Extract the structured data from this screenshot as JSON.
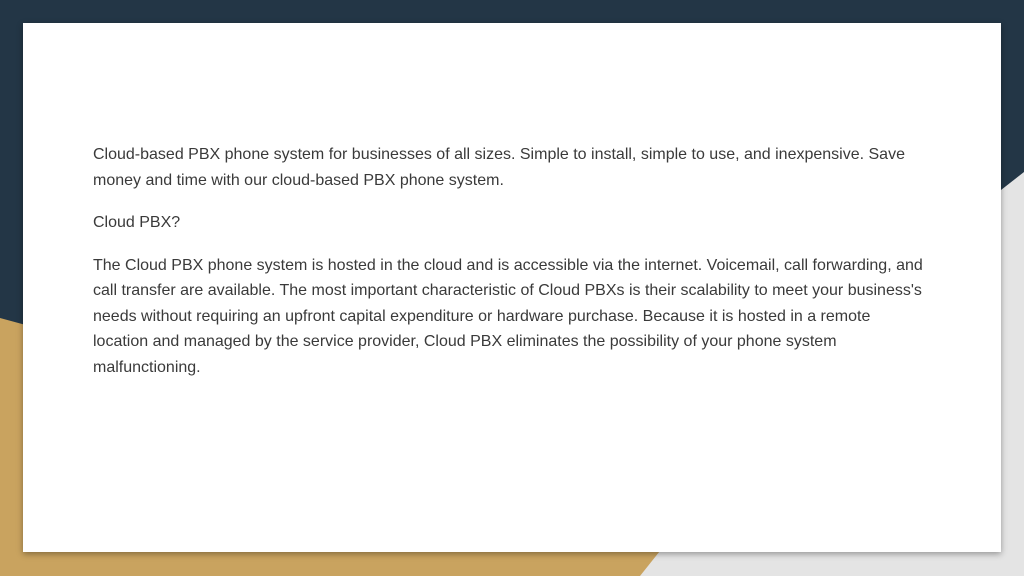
{
  "slide": {
    "paragraphs": [
      "Cloud-based PBX phone system for businesses of all sizes. Simple to install, simple to use, and inexpensive. Save money and time with our cloud-based PBX phone system.",
      "Cloud PBX?",
      "The Cloud PBX phone system is hosted in the cloud and is accessible via the internet. Voicemail, call forwarding, and call transfer are available. The most important characteristic of Cloud PBXs is their scalability to meet your business's needs without requiring an upfront capital expenditure or hardware purchase. Because it is hosted in a remote location and managed by the service provider, Cloud PBX eliminates the possibility of your phone system malfunctioning."
    ]
  },
  "colors": {
    "navy": "#233646",
    "gold": "#c9a35f",
    "light_gray": "#e4e4e4",
    "card": "#ffffff",
    "text": "#3a3a3a"
  }
}
